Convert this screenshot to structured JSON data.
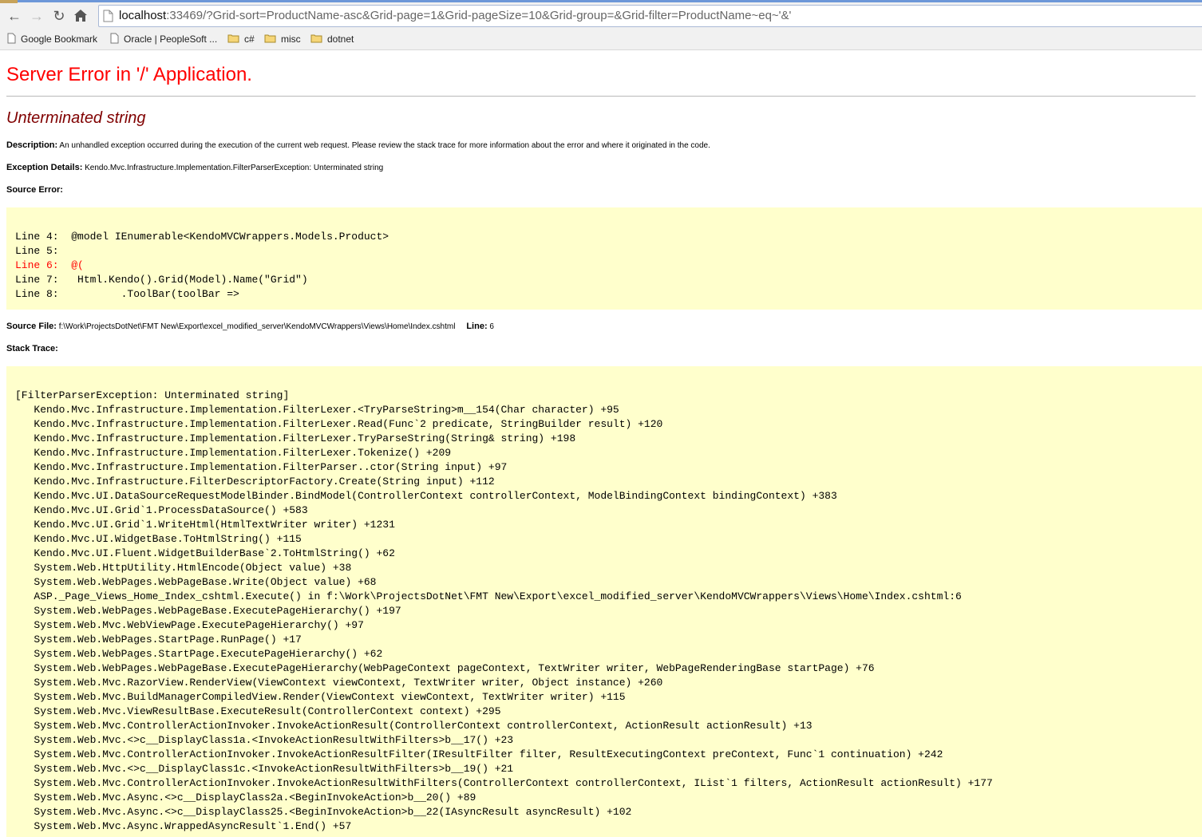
{
  "browser": {
    "url_host": "localhost",
    "url_rest": ":33469/?Grid-sort=ProductName-asc&Grid-page=1&Grid-pageSize=10&Grid-group=&Grid-filter=ProductName~eq~'&'",
    "bookmarks": [
      {
        "label": "Google Bookmark",
        "icon": "page-icon"
      },
      {
        "label": "Oracle | PeopleSoft ...",
        "icon": "page-icon"
      },
      {
        "label": "c#",
        "icon": "folder-icon"
      },
      {
        "label": "misc",
        "icon": "folder-icon"
      },
      {
        "label": "dotnet",
        "icon": "folder-icon"
      }
    ]
  },
  "page": {
    "title": "Server Error in '/' Application.",
    "error_title": "Unterminated string",
    "description_label": "Description:",
    "description_text": "An unhandled exception occurred during the execution of the current web request. Please review the stack trace for more information about the error and where it originated in the code.",
    "exception_label": "Exception Details:",
    "exception_text": "Kendo.Mvc.Infrastructure.Implementation.FilterParserException: Unterminated string",
    "source_error_label": "Source Error:",
    "source_lines": [
      {
        "text": "Line 4:  @model IEnumerable<KendoMVCWrappers.Models.Product>",
        "highlight": false
      },
      {
        "text": "Line 5:",
        "highlight": false
      },
      {
        "text": "Line 6:  @(",
        "highlight": true
      },
      {
        "text": "Line 7:   Html.Kendo().Grid(Model).Name(\"Grid\")",
        "highlight": false
      },
      {
        "text": "Line 8:          .ToolBar(toolBar =>",
        "highlight": false
      }
    ],
    "source_file_label": "Source File:",
    "source_file_path": "f:\\Work\\ProjectsDotNet\\FMT New\\Export\\excel_modified_server\\KendoMVCWrappers\\Views\\Home\\Index.cshtml",
    "line_label": "Line:",
    "line_number": "6",
    "stack_trace_label": "Stack Trace:",
    "stack_trace": [
      "[FilterParserException: Unterminated string]",
      "   Kendo.Mvc.Infrastructure.Implementation.FilterLexer.<TryParseString>m__154(Char character) +95",
      "   Kendo.Mvc.Infrastructure.Implementation.FilterLexer.Read(Func`2 predicate, StringBuilder result) +120",
      "   Kendo.Mvc.Infrastructure.Implementation.FilterLexer.TryParseString(String& string) +198",
      "   Kendo.Mvc.Infrastructure.Implementation.FilterLexer.Tokenize() +209",
      "   Kendo.Mvc.Infrastructure.Implementation.FilterParser..ctor(String input) +97",
      "   Kendo.Mvc.Infrastructure.FilterDescriptorFactory.Create(String input) +112",
      "   Kendo.Mvc.UI.DataSourceRequestModelBinder.BindModel(ControllerContext controllerContext, ModelBindingContext bindingContext) +383",
      "   Kendo.Mvc.UI.Grid`1.ProcessDataSource() +583",
      "   Kendo.Mvc.UI.Grid`1.WriteHtml(HtmlTextWriter writer) +1231",
      "   Kendo.Mvc.UI.WidgetBase.ToHtmlString() +115",
      "   Kendo.Mvc.UI.Fluent.WidgetBuilderBase`2.ToHtmlString() +62",
      "   System.Web.HttpUtility.HtmlEncode(Object value) +38",
      "   System.Web.WebPages.WebPageBase.Write(Object value) +68",
      "   ASP._Page_Views_Home_Index_cshtml.Execute() in f:\\Work\\ProjectsDotNet\\FMT New\\Export\\excel_modified_server\\KendoMVCWrappers\\Views\\Home\\Index.cshtml:6",
      "   System.Web.WebPages.WebPageBase.ExecutePageHierarchy() +197",
      "   System.Web.Mvc.WebViewPage.ExecutePageHierarchy() +97",
      "   System.Web.WebPages.StartPage.RunPage() +17",
      "   System.Web.WebPages.StartPage.ExecutePageHierarchy() +62",
      "   System.Web.WebPages.WebPageBase.ExecutePageHierarchy(WebPageContext pageContext, TextWriter writer, WebPageRenderingBase startPage) +76",
      "   System.Web.Mvc.RazorView.RenderView(ViewContext viewContext, TextWriter writer, Object instance) +260",
      "   System.Web.Mvc.BuildManagerCompiledView.Render(ViewContext viewContext, TextWriter writer) +115",
      "   System.Web.Mvc.ViewResultBase.ExecuteResult(ControllerContext context) +295",
      "   System.Web.Mvc.ControllerActionInvoker.InvokeActionResult(ControllerContext controllerContext, ActionResult actionResult) +13",
      "   System.Web.Mvc.<>c__DisplayClass1a.<InvokeActionResultWithFilters>b__17() +23",
      "   System.Web.Mvc.ControllerActionInvoker.InvokeActionResultFilter(IResultFilter filter, ResultExecutingContext preContext, Func`1 continuation) +242",
      "   System.Web.Mvc.<>c__DisplayClass1c.<InvokeActionResultWithFilters>b__19() +21",
      "   System.Web.Mvc.ControllerActionInvoker.InvokeActionResultWithFilters(ControllerContext controllerContext, IList`1 filters, ActionResult actionResult) +177",
      "   System.Web.Mvc.Async.<>c__DisplayClass2a.<BeginInvokeAction>b__20() +89",
      "   System.Web.Mvc.Async.<>c__DisplayClass25.<BeginInvokeAction>b__22(IAsyncResult asyncResult) +102",
      "   System.Web.Mvc.Async.WrappedAsyncResult`1.End() +57"
    ]
  }
}
